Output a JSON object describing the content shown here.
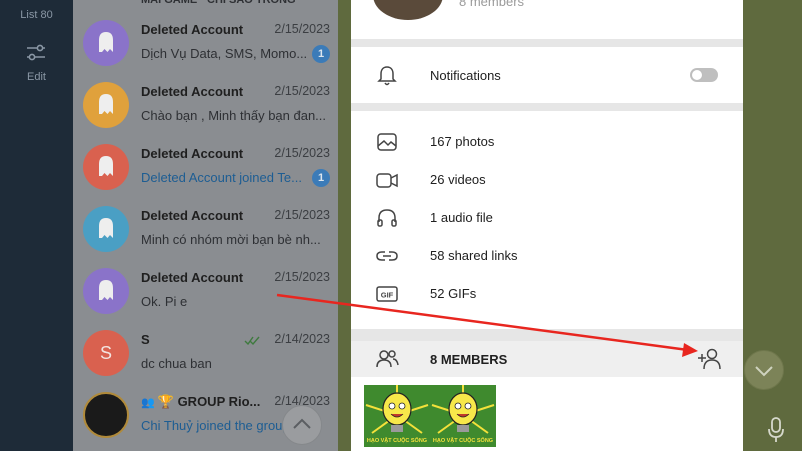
{
  "rail": {
    "list_label": "List 80",
    "edit_label": "Edit"
  },
  "chats": [
    {
      "name": "Deleted Account",
      "date": "2/15/2023",
      "message": "Dịch Vụ Data, SMS, Momo...",
      "badge": "1",
      "avatar_color": "#8a73c9",
      "blue": false
    },
    {
      "name": "Deleted Account",
      "date": "2/15/2023",
      "message": "Chào bạn , Minh thấy bạn đan...",
      "badge": "",
      "avatar_color": "#e0a13c",
      "blue": false
    },
    {
      "name": "Deleted Account",
      "date": "2/15/2023",
      "message": "Deleted Account joined Te...",
      "badge": "1",
      "avatar_color": "#d9614f",
      "blue": true
    },
    {
      "name": "Deleted Account",
      "date": "2/15/2023",
      "message": "Minh có nhóm mời bạn bè nh...",
      "badge": "",
      "avatar_color": "#4a9fc4",
      "blue": false
    },
    {
      "name": "Deleted Account",
      "date": "2/15/2023",
      "message": "Ok. Pi e",
      "badge": "",
      "avatar_color": "#8a73c9",
      "blue": false
    },
    {
      "name": "S",
      "date": "2/14/2023",
      "message": "dc chua ban",
      "badge": "",
      "avatar_color": "#d9614f",
      "blue": false,
      "letter": "S",
      "read": true
    },
    {
      "name": "🏆 GROUP Rio...",
      "date": "2/14/2023",
      "message": "Chi Thuỷ joined the group",
      "badge": "",
      "avatar_color": "#1a1a1a",
      "blue": true,
      "group": true
    }
  ],
  "profile": {
    "subtitle": "8 members"
  },
  "notifications": {
    "label": "Notifications",
    "enabled": false
  },
  "media": [
    {
      "icon": "photo-icon",
      "label": "167 photos"
    },
    {
      "icon": "video-icon",
      "label": "26 videos"
    },
    {
      "icon": "headphones-icon",
      "label": "1 audio file"
    },
    {
      "icon": "link-icon",
      "label": "58 shared links"
    },
    {
      "icon": "gif-icon",
      "label": "52 GIFs"
    }
  ],
  "members": {
    "label": "8 MEMBERS"
  },
  "sticker_caption": "HẠO VẬT CUỘC SỐNG",
  "colors": {
    "accent": "#3b7bb8",
    "annotation_arrow": "#e8261f"
  }
}
